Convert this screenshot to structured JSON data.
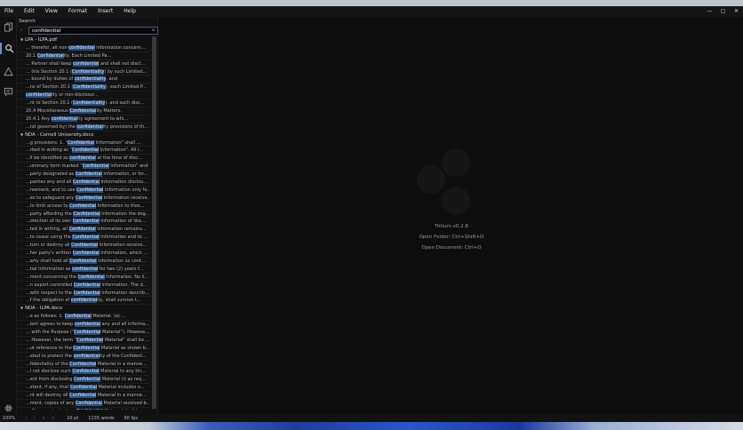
{
  "menu": [
    "File",
    "Edit",
    "View",
    "Format",
    "Insert",
    "Help"
  ],
  "window_controls": [
    "—",
    "▢",
    "✕"
  ],
  "panel": {
    "title": "Search",
    "query": "confidential",
    "option_glyph": "≈"
  },
  "results": [
    {
      "file": "LPA - ILPA.pdf",
      "lines": [
        [
          "... therefor, all non-",
          "confidential",
          " information concern..."
        ],
        [
          "20.1 ",
          "Confidential",
          "ity. Each Limited Pa..."
        ],
        [
          "... Partner shall keep ",
          "confidential",
          " and shall not discl..."
        ],
        [
          "... this Section 20.1 (",
          "Confidentiality",
          ") by such Limited..."
        ],
        [
          "... bound by duties of ",
          "confidentiality",
          ", and"
        ],
        [
          "...ns of Section 20.1 (",
          "Confidentiality",
          "), each Limited P..."
        ],
        [
          "",
          "confidential",
          "ity or non-disclosur..."
        ],
        [
          "...nt to Section 20.1 (",
          "Confidentiality",
          "), and such disc..."
        ],
        [
          "20.4 Miscellaneous ",
          "Confidential",
          "ity Matters."
        ],
        [
          "20.4.1 Any ",
          "confidential",
          "ity agreement to whi..."
        ],
        [
          "...nd governed by) the ",
          "confidential",
          "ity provisions of th..."
        ]
      ]
    },
    {
      "file": "NDA - Cornell University.docx",
      "lines": [
        [
          "...g provisions: 1.  “",
          "Confidential",
          " Information” shall ..."
        ],
        [
          "...rked in writing as “",
          "Confidential",
          " Information”. All i..."
        ],
        [
          "...ll be identified as ",
          "confidential",
          " at the time of disc..."
        ],
        [
          "...ummary form marked “",
          "Confidential",
          " Information” and tr..."
        ],
        [
          "...perly designated as ",
          "Confidential",
          " Information, or for..."
        ],
        [
          "...parties any and all ",
          "Confidential",
          " Information disclos..."
        ],
        [
          "...reement, and to use ",
          "Confidential",
          " Information only fo..."
        ],
        [
          "...es to safeguard any ",
          "Confidential",
          " Information receive..."
        ],
        [
          "...to limit access to ",
          "Confidential",
          " Information to thos..."
        ],
        [
          "...party affording the ",
          "Confidential",
          " Information the deg..."
        ],
        [
          "...otection of its own ",
          "Confidential",
          " Information of like..."
        ],
        [
          "...ted in writing, all ",
          "Confidential",
          " Information remains..."
        ],
        [
          "...to cease using the ",
          "Confidential",
          " Information and to ..."
        ],
        [
          "...turn or destroy all ",
          "Confidential",
          " Information receive..."
        ],
        [
          "...her party's written ",
          "Confidential",
          " Information, which ..."
        ],
        [
          "...arty shall hold all ",
          "Confidential",
          " Information as conf..."
        ],
        [
          "...tial Information as ",
          "confidential",
          " for two (2) years f..."
        ],
        [
          "...ment concerning the ",
          "Confidential",
          " Information.  No li..."
        ],
        [
          "...n export controlled ",
          "Confidential",
          " Information.  The d..."
        ],
        [
          "...with respect to the ",
          "Confidential",
          " Information describ..."
        ],
        [
          "...f the obligation of ",
          "confidential",
          "ity, shall survive t..."
        ]
      ]
    },
    {
      "file": "NDA - ILPA.docx",
      "lines": [
        [
          "...e as follows: 1.    ",
          "Confidential",
          " Material.  (a)     ..."
        ],
        [
          "...lent agrees to keep ",
          "confidential",
          " any and all informa..."
        ],
        [
          "... with the Purpose (“",
          "Confidential",
          " Material”).  Howeve..."
        ],
        [
          "... However, the term “",
          "Confidential",
          " Material” shall be ..."
        ],
        [
          "...ut reference to the ",
          "Confidential",
          " Material as shown b..."
        ],
        [
          "...ated to protect the ",
          "confidential",
          "ity of the Confident..."
        ],
        [
          "...fidentiality of the ",
          "Confidential",
          " Material in a manne..."
        ],
        [
          "...l not disclose such ",
          "Confidential",
          " Material to any thi..."
        ],
        [
          "...ent from disclosing ",
          "Confidential",
          " Material (i) as req..."
        ],
        [
          "...xtent, if any, that ",
          "Confidential",
          " Material includes o..."
        ],
        [
          "...nt will destroy all ",
          "Confidential",
          " Material in a manne..."
        ],
        [
          "...ment, copies of any ",
          "Confidential",
          " Material received b..."
        ],
        [
          "... Manager to destroy ",
          "Confidential",
          " Material shall have..."
        ]
      ]
    }
  ],
  "welcome": {
    "app": "Tritium v0.2.8",
    "open_folder": "Open Folder: Ctrl+Shift+O",
    "open_document": "Open Document: Ctrl+O"
  },
  "status": {
    "zoom": "100%",
    "font_size": "10 pt",
    "words": "1135 words",
    "fps": "60 fps",
    "nav_glyphs": "‹ › « »"
  },
  "colors": {
    "highlight": "#264e80",
    "accent": "#6b8fd6"
  }
}
